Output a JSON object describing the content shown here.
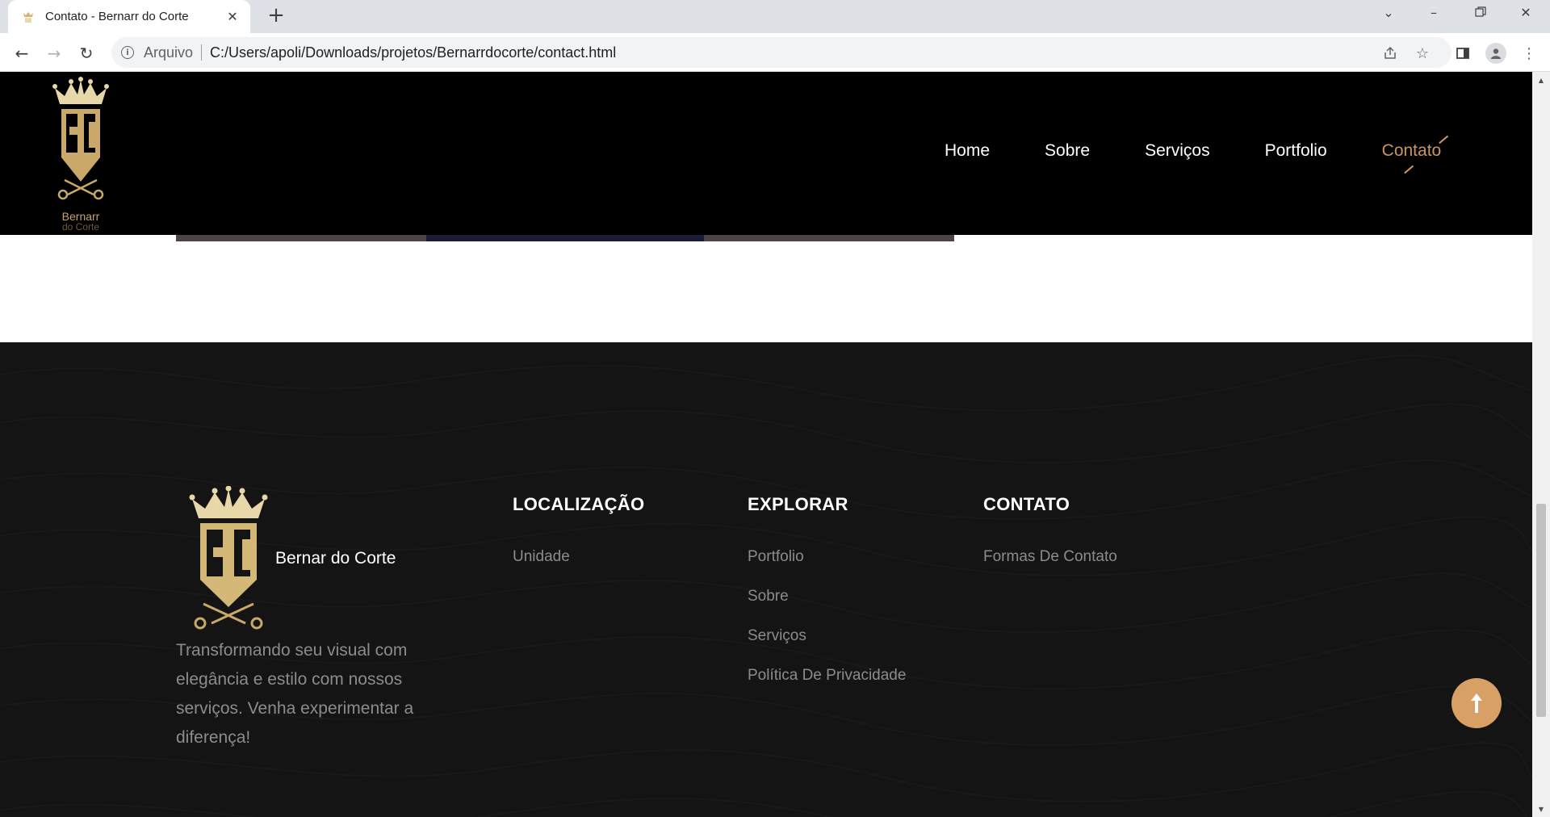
{
  "browser": {
    "tab_title": "Contato - Bernarr do Corte",
    "tab_close": "✕",
    "new_tab": "+",
    "omnibox_label": "Arquivo",
    "url": "C:/Users/apoli/Downloads/projetos/Bernarrdocorte/contact.html"
  },
  "header": {
    "brand_name": "Bernarr",
    "brand_sub": "do Corte",
    "nav": [
      "Home",
      "Sobre",
      "Serviços",
      "Portfolio",
      "Contato"
    ],
    "active_nav": "Contato"
  },
  "footer": {
    "brand_name": "Bernar do Corte",
    "tagline": "Transformando seu visual com elegância e estilo com nossos serviços. Venha experimentar a diferença!",
    "columns": [
      {
        "title": "LOCALIZAÇÃO",
        "links": [
          "Unidade"
        ]
      },
      {
        "title": "EXPLORAR",
        "links": [
          "Portfolio",
          "Sobre",
          "Serviços",
          "Política De Privacidade"
        ]
      },
      {
        "title": "CONTATO",
        "links": [
          "Formas De Contato"
        ]
      }
    ]
  },
  "colors": {
    "accent": "#c9955d",
    "scroll_top_button": "#d9a066",
    "header_bg": "#000000",
    "footer_bg": "#141414"
  }
}
